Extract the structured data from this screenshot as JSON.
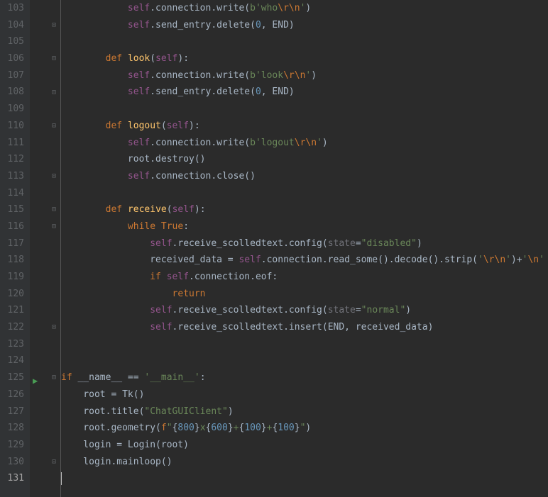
{
  "lines": [
    {
      "n": 103,
      "indent": 3,
      "tokens": [
        [
          "self",
          "self"
        ],
        [
          "",
          ".connection.write("
        ],
        [
          "str",
          "b'who"
        ],
        [
          "esc",
          "\\r\\n"
        ],
        [
          "str",
          "'"
        ],
        [
          "",
          ")"
        ]
      ]
    },
    {
      "n": 104,
      "indent": 3,
      "fold": "close",
      "tokens": [
        [
          "self",
          "self"
        ],
        [
          "",
          ".send_entry.delete("
        ],
        [
          "num",
          "0"
        ],
        [
          "",
          ", END)"
        ]
      ]
    },
    {
      "n": 105,
      "indent": 0,
      "tokens": []
    },
    {
      "n": 106,
      "indent": 2,
      "fold": "open",
      "tokens": [
        [
          "kw",
          "def "
        ],
        [
          "fn",
          "look"
        ],
        [
          "",
          "("
        ],
        [
          "self",
          "self"
        ],
        [
          "",
          "):"
        ]
      ]
    },
    {
      "n": 107,
      "indent": 3,
      "tokens": [
        [
          "self",
          "self"
        ],
        [
          "",
          ".connection.write("
        ],
        [
          "str",
          "b'look"
        ],
        [
          "esc",
          "\\r\\n"
        ],
        [
          "str",
          "'"
        ],
        [
          "",
          ")"
        ]
      ]
    },
    {
      "n": 108,
      "indent": 3,
      "fold": "close",
      "tokens": [
        [
          "self",
          "self"
        ],
        [
          "",
          ".send_entry.delete("
        ],
        [
          "num",
          "0"
        ],
        [
          "",
          ", END)"
        ]
      ]
    },
    {
      "n": 109,
      "indent": 0,
      "tokens": []
    },
    {
      "n": 110,
      "indent": 2,
      "fold": "open",
      "tokens": [
        [
          "kw",
          "def "
        ],
        [
          "fn",
          "logout"
        ],
        [
          "",
          "("
        ],
        [
          "self",
          "self"
        ],
        [
          "",
          "):"
        ]
      ]
    },
    {
      "n": 111,
      "indent": 3,
      "tokens": [
        [
          "self",
          "self"
        ],
        [
          "",
          ".connection.write("
        ],
        [
          "str",
          "b'logout"
        ],
        [
          "esc",
          "\\r\\n"
        ],
        [
          "str",
          "'"
        ],
        [
          "",
          ")"
        ]
      ]
    },
    {
      "n": 112,
      "indent": 3,
      "tokens": [
        [
          "",
          "root.destroy()"
        ]
      ]
    },
    {
      "n": 113,
      "indent": 3,
      "fold": "close",
      "tokens": [
        [
          "self",
          "self"
        ],
        [
          "",
          ".connection.close()"
        ]
      ]
    },
    {
      "n": 114,
      "indent": 0,
      "tokens": []
    },
    {
      "n": 115,
      "indent": 2,
      "fold": "open",
      "tokens": [
        [
          "kw",
          "def "
        ],
        [
          "fn",
          "receive"
        ],
        [
          "",
          "("
        ],
        [
          "self",
          "self"
        ],
        [
          "",
          "):"
        ]
      ]
    },
    {
      "n": 116,
      "indent": 3,
      "fold": "open",
      "tokens": [
        [
          "kw",
          "while True"
        ],
        [
          "",
          ":"
        ]
      ]
    },
    {
      "n": 117,
      "indent": 4,
      "tokens": [
        [
          "self",
          "self"
        ],
        [
          "",
          ".receive_scolledtext.config("
        ],
        [
          "param",
          "state"
        ],
        [
          "",
          "="
        ],
        [
          "str",
          "\"disabled\""
        ],
        [
          "",
          ")"
        ]
      ]
    },
    {
      "n": 118,
      "indent": 4,
      "tokens": [
        [
          "",
          "received_data = "
        ],
        [
          "self",
          "self"
        ],
        [
          "",
          ".connection.read_some().decode().strip("
        ],
        [
          "str",
          "'"
        ],
        [
          "esc",
          "\\r\\n"
        ],
        [
          "str",
          "'"
        ],
        [
          "",
          ")+"
        ],
        [
          "str",
          "'"
        ],
        [
          "esc",
          "\\n"
        ],
        [
          "str",
          "'"
        ]
      ]
    },
    {
      "n": 119,
      "indent": 4,
      "tokens": [
        [
          "kw",
          "if "
        ],
        [
          "self",
          "self"
        ],
        [
          "",
          ".connection.eof:"
        ]
      ]
    },
    {
      "n": 120,
      "indent": 5,
      "tokens": [
        [
          "kw",
          "return"
        ]
      ]
    },
    {
      "n": 121,
      "indent": 4,
      "tokens": [
        [
          "self",
          "self"
        ],
        [
          "",
          ".receive_scolledtext.config("
        ],
        [
          "param",
          "state"
        ],
        [
          "",
          "="
        ],
        [
          "str",
          "\"normal\""
        ],
        [
          "",
          ")"
        ]
      ]
    },
    {
      "n": 122,
      "indent": 4,
      "fold": "close",
      "tokens": [
        [
          "self",
          "self"
        ],
        [
          "",
          ".receive_scolledtext.insert(END, received_data)"
        ]
      ]
    },
    {
      "n": 123,
      "indent": 0,
      "tokens": []
    },
    {
      "n": 124,
      "indent": 0,
      "tokens": []
    },
    {
      "n": 125,
      "indent": 0,
      "run": true,
      "fold": "open",
      "tokens": [
        [
          "kw",
          "if "
        ],
        [
          "",
          "__name__ == "
        ],
        [
          "str",
          "'__main__'"
        ],
        [
          "",
          ":"
        ]
      ]
    },
    {
      "n": 126,
      "indent": 1,
      "tokens": [
        [
          "",
          "root = Tk()"
        ]
      ]
    },
    {
      "n": 127,
      "indent": 1,
      "tokens": [
        [
          "",
          "root.title("
        ],
        [
          "str",
          "\"ChatGUIClient\""
        ],
        [
          "",
          ")"
        ]
      ]
    },
    {
      "n": 128,
      "indent": 1,
      "tokens": [
        [
          "",
          "root.geometry("
        ],
        [
          "kw",
          "f"
        ],
        [
          "str",
          "\""
        ],
        [
          "",
          "{"
        ],
        [
          "num",
          "800"
        ],
        [
          "",
          "}"
        ],
        [
          "str",
          "x"
        ],
        [
          "",
          "{"
        ],
        [
          "num",
          "600"
        ],
        [
          "",
          "}"
        ],
        [
          "str",
          "+"
        ],
        [
          "",
          "{"
        ],
        [
          "num",
          "100"
        ],
        [
          "",
          "}"
        ],
        [
          "str",
          "+"
        ],
        [
          "",
          "{"
        ],
        [
          "num",
          "100"
        ],
        [
          "",
          "}"
        ],
        [
          "str",
          "\""
        ],
        [
          "",
          ")"
        ]
      ]
    },
    {
      "n": 129,
      "indent": 1,
      "tokens": [
        [
          "",
          "login = Login(root)"
        ]
      ]
    },
    {
      "n": 130,
      "indent": 1,
      "fold": "close",
      "tokens": [
        [
          "",
          "login.mainloop()"
        ]
      ]
    },
    {
      "n": 131,
      "indent": 0,
      "current": true,
      "caret": true,
      "tokens": []
    }
  ],
  "indent_unit": "    "
}
